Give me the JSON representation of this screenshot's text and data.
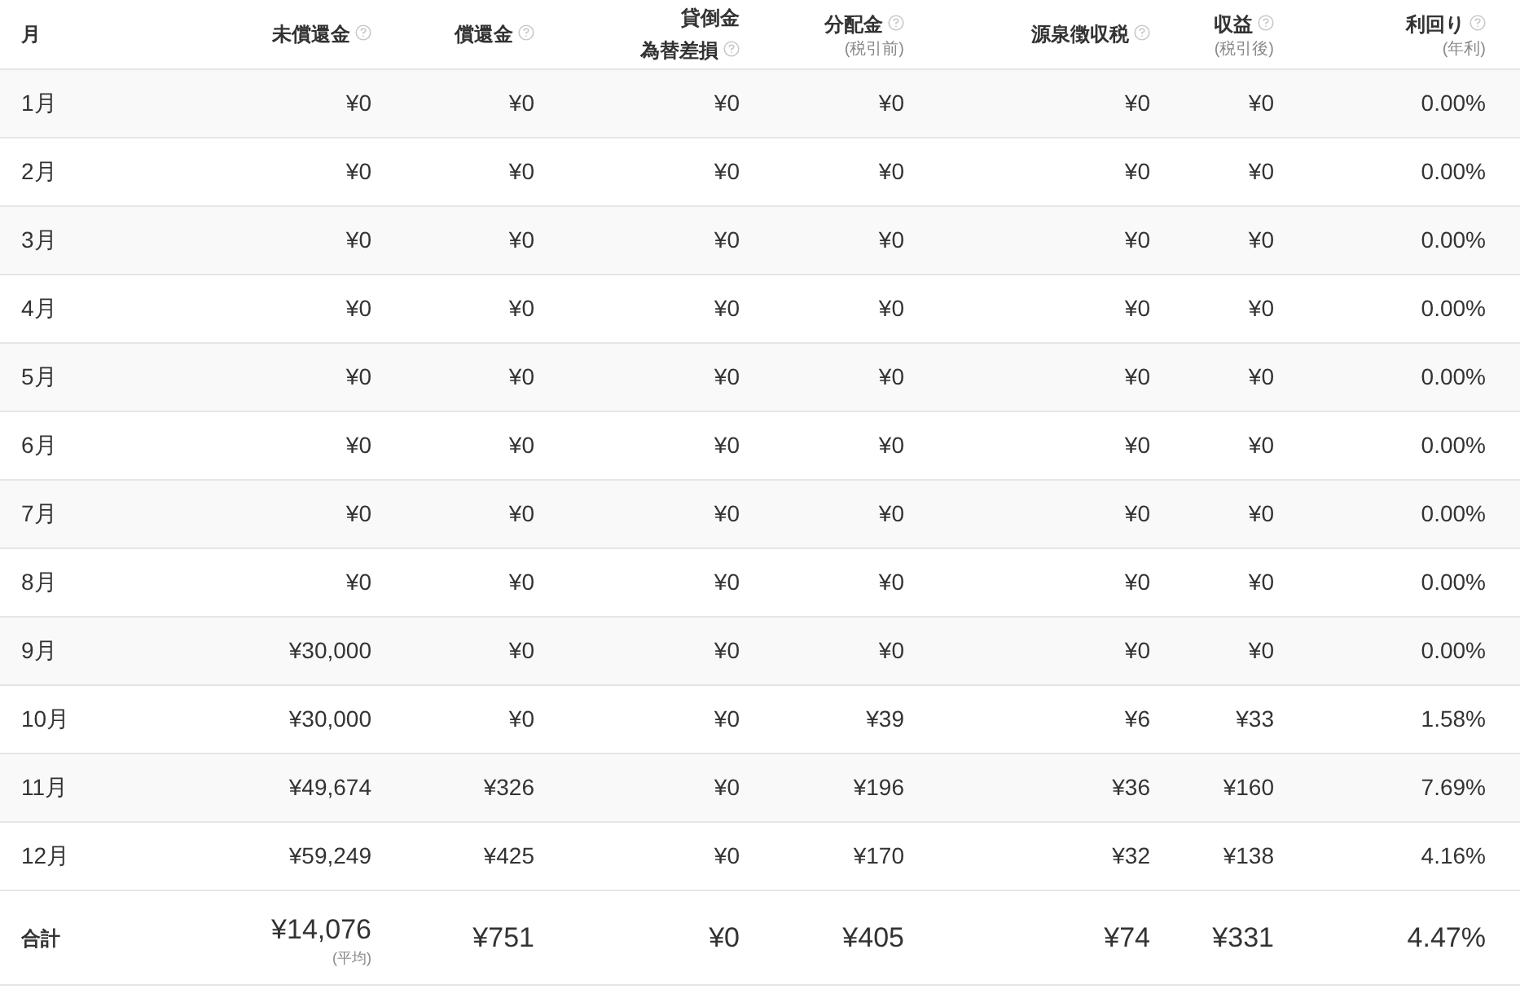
{
  "table": {
    "columns": [
      {
        "lines": [
          "月"
        ],
        "help": false
      },
      {
        "lines": [
          "未償還金"
        ],
        "help": true
      },
      {
        "lines": [
          "償還金"
        ],
        "help": true
      },
      {
        "lines": [
          "貸倒金",
          "為替差損"
        ],
        "help": true
      },
      {
        "lines": [
          "分配金"
        ],
        "help": true,
        "note": "(税引前)"
      },
      {
        "lines": [
          "源泉徴収税"
        ],
        "help": true
      },
      {
        "lines": [
          "収益"
        ],
        "help": true,
        "note": "(税引後)"
      },
      {
        "lines": [
          "利回り"
        ],
        "help": true,
        "note": "(年利)"
      }
    ],
    "rows": [
      [
        "1月",
        "¥0",
        "¥0",
        "¥0",
        "¥0",
        "¥0",
        "¥0",
        "0.00%"
      ],
      [
        "2月",
        "¥0",
        "¥0",
        "¥0",
        "¥0",
        "¥0",
        "¥0",
        "0.00%"
      ],
      [
        "3月",
        "¥0",
        "¥0",
        "¥0",
        "¥0",
        "¥0",
        "¥0",
        "0.00%"
      ],
      [
        "4月",
        "¥0",
        "¥0",
        "¥0",
        "¥0",
        "¥0",
        "¥0",
        "0.00%"
      ],
      [
        "5月",
        "¥0",
        "¥0",
        "¥0",
        "¥0",
        "¥0",
        "¥0",
        "0.00%"
      ],
      [
        "6月",
        "¥0",
        "¥0",
        "¥0",
        "¥0",
        "¥0",
        "¥0",
        "0.00%"
      ],
      [
        "7月",
        "¥0",
        "¥0",
        "¥0",
        "¥0",
        "¥0",
        "¥0",
        "0.00%"
      ],
      [
        "8月",
        "¥0",
        "¥0",
        "¥0",
        "¥0",
        "¥0",
        "¥0",
        "0.00%"
      ],
      [
        "9月",
        "¥30,000",
        "¥0",
        "¥0",
        "¥0",
        "¥0",
        "¥0",
        "0.00%"
      ],
      [
        "10月",
        "¥30,000",
        "¥0",
        "¥0",
        "¥39",
        "¥6",
        "¥33",
        "1.58%"
      ],
      [
        "11月",
        "¥49,674",
        "¥326",
        "¥0",
        "¥196",
        "¥36",
        "¥160",
        "7.69%"
      ],
      [
        "12月",
        "¥59,249",
        "¥425",
        "¥0",
        "¥170",
        "¥32",
        "¥138",
        "4.16%"
      ]
    ],
    "total": {
      "cells": [
        {
          "value": "合計"
        },
        {
          "value": "¥14,076",
          "note": "(平均)"
        },
        {
          "value": "¥751"
        },
        {
          "value": "¥0"
        },
        {
          "value": "¥405"
        },
        {
          "value": "¥74"
        },
        {
          "value": "¥331"
        },
        {
          "value": "4.47%"
        }
      ]
    }
  }
}
